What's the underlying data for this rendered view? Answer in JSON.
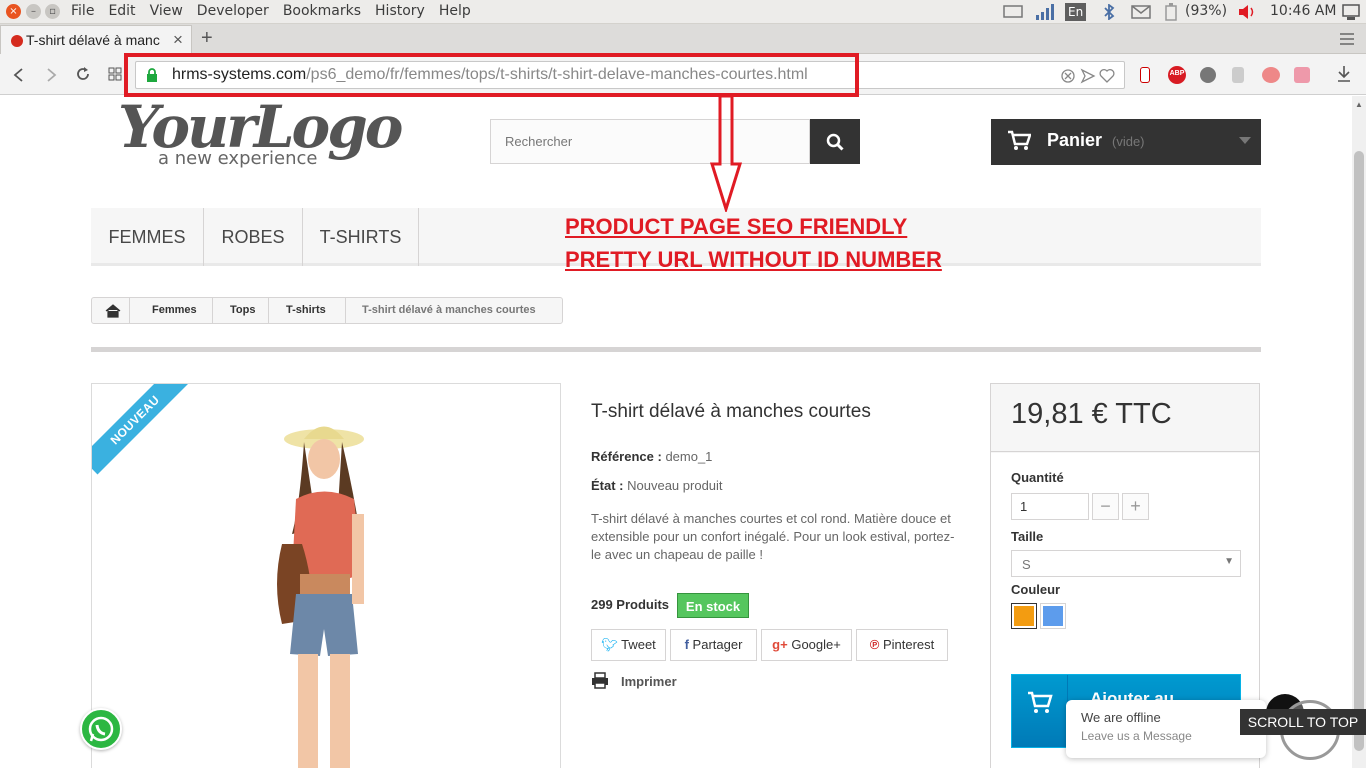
{
  "os": {
    "menus": [
      "File",
      "Edit",
      "View",
      "Developer",
      "Bookmarks",
      "History",
      "Help"
    ],
    "keyboard": "En",
    "battery": "(93%)",
    "clock": "10:46 AM"
  },
  "browser": {
    "tab_title": "T-shirt délavé à manc",
    "tab_close": "×",
    "new_tab": "+",
    "url_host": "hrms-systems.com",
    "url_path": "/ps6_demo/fr/femmes/tops/t-shirts/t-shirt-delave-manches-courtes.html",
    "abp": "ABP"
  },
  "annotation": {
    "line1": "PRODUCT PAGE SEO FRIENDLY",
    "line2": "PRETTY URL WITHOUT ID NUMBER"
  },
  "header": {
    "logo_main": "YourLogo",
    "logo_sub": "a new experience",
    "search_placeholder": "Rechercher",
    "cart_label": "Panier",
    "cart_status": "(vide)"
  },
  "menu": [
    "FEMMES",
    "ROBES",
    "T-SHIRTS"
  ],
  "breadcrumb": [
    "Femmes",
    "Tops",
    "T-shirts",
    "T-shirt délavé à manches courtes"
  ],
  "product": {
    "badge": "NOUVEAU",
    "name": "T-shirt délavé à manches courtes",
    "reference_label": "Référence :",
    "reference": "demo_1",
    "condition_label": "État :",
    "condition": "Nouveau produit",
    "description": "T-shirt délavé à manches courtes et col rond. Matière douce et extensible pour un confort inégalé. Pour un look estival, portez-le avec un chapeau de paille !",
    "quantity_text": "299 Produits",
    "stock": "En stock",
    "share": [
      "Tweet",
      "Partager",
      "Google+",
      "Pinterest"
    ],
    "print": "Imprimer"
  },
  "buy": {
    "price": "19,81 € TTC",
    "qty_label": "Quantité",
    "qty_value": "1",
    "minus": "−",
    "plus": "+",
    "size_label": "Taille",
    "size_value": "S",
    "color_label": "Couleur",
    "colors": [
      "#f39c11",
      "#5d9cec"
    ],
    "add_to_cart": "Ajouter au"
  },
  "widgets": {
    "chat_title": "We are offline",
    "chat_sub": "Leave us a Message",
    "scroll_top": "SCROLL TO TOP"
  }
}
